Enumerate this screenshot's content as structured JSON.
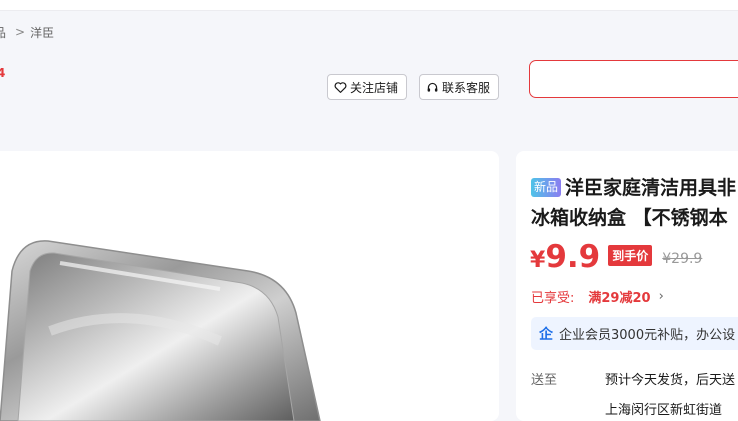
{
  "breadcrumb": {
    "start": "品",
    "current": "洋臣"
  },
  "store": {
    "score": "4"
  },
  "actions": {
    "follow_label": "关注店铺",
    "service_label": "联系客服"
  },
  "product": {
    "badge": "新品",
    "title_line1": "洋臣家庭清洁用具非",
    "title_line2": "冰箱收纳盒 【不锈钢本",
    "currency": "¥",
    "price": "9.9",
    "hand_price_label": "到手价",
    "original_price": "¥29.9",
    "promo_label": "已享受:",
    "promo_value": "满29减20",
    "enterprise_text": "企业会员3000元补贴，办公设",
    "ship_label": "送至",
    "ship_value": "预计今天发货，后天送",
    "address": "上海闵行区新虹街道"
  },
  "colors": {
    "accent": "#e4393c",
    "enterprise_bg": "#eef4ff",
    "enterprise_icon": "#1e6fe8"
  }
}
